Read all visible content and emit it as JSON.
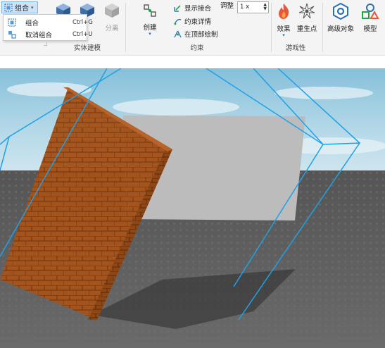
{
  "ribbon": {
    "group_button_label": "组合",
    "tools": {
      "separate": "分离",
      "create": "创建",
      "show_welds": "显示接合",
      "constraint_details": "约束详情",
      "draw_on_top": "在顶部绘制",
      "adjust_label": "调整",
      "adjust_value": "1 x",
      "effects": "效果",
      "spawn": "重生点",
      "advanced_objects": "高级对象",
      "model": "模型"
    },
    "groups": {
      "solid_modeling": "实体建模",
      "constraints": "约束",
      "gameplay": "游戏性"
    }
  },
  "dropdown_menu": {
    "items": [
      {
        "label": "组合",
        "shortcut": "Ctrl+G",
        "icon": "group-icon"
      },
      {
        "label": "取消组合",
        "shortcut": "Ctrl+U",
        "icon": "ungroup-icon"
      }
    ]
  },
  "colors": {
    "ribbon_bg": "#f4f4f4",
    "selection_blue": "#1fa1e6",
    "sky_top": "#8fc6de",
    "baseplate": "#5a5a5a",
    "brick": "#a4531b",
    "grey_part": "#b9b9b9"
  }
}
